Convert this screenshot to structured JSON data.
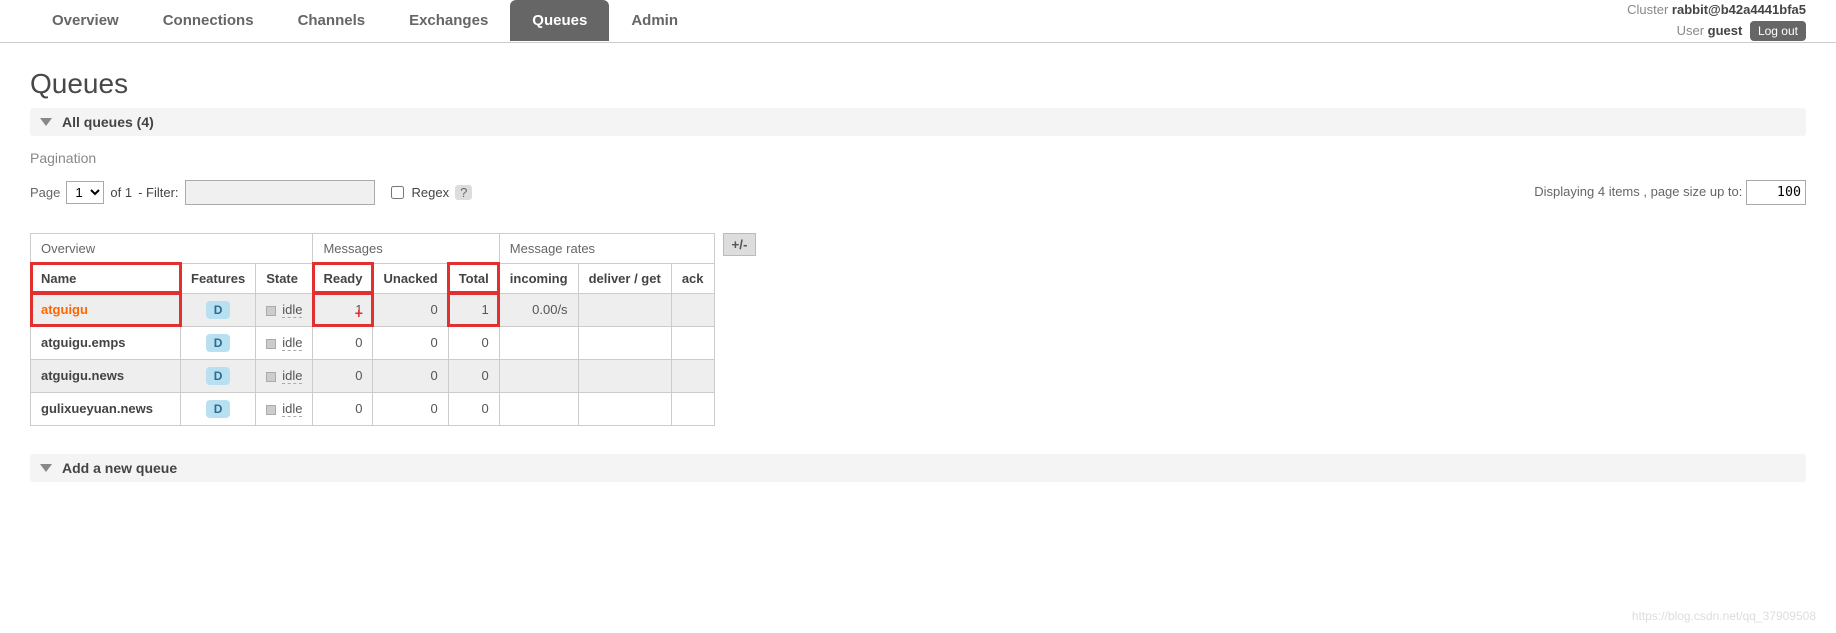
{
  "cluster": {
    "label": "Cluster",
    "name": "rabbit@b42a4441bfa5"
  },
  "user": {
    "label": "User",
    "name": "guest",
    "logout": "Log out"
  },
  "tabs": [
    {
      "label": "Overview"
    },
    {
      "label": "Connections"
    },
    {
      "label": "Channels"
    },
    {
      "label": "Exchanges"
    },
    {
      "label": "Queues"
    },
    {
      "label": "Admin"
    }
  ],
  "page_title": "Queues",
  "sections": {
    "all_queues": "All queues (4)",
    "add_queue": "Add a new queue"
  },
  "pagination": {
    "label": "Pagination",
    "page_label": "Page",
    "page_value": "1",
    "of_label": "of 1",
    "filter_label": "- Filter:",
    "filter_value": "",
    "regex_label": "Regex",
    "help": "?",
    "display_label": "Displaying 4 items , page size up to:",
    "pagesize_value": "100"
  },
  "table": {
    "group_headers": {
      "overview": "Overview",
      "messages": "Messages",
      "rates": "Message rates"
    },
    "headers": {
      "name": "Name",
      "features": "Features",
      "state": "State",
      "ready": "Ready",
      "unacked": "Unacked",
      "total": "Total",
      "incoming": "incoming",
      "deliver": "deliver / get",
      "ack": "ack"
    },
    "rows": [
      {
        "name": "atguigu",
        "feature": "D",
        "state": "idle",
        "ready": "1",
        "unacked": "0",
        "total": "1",
        "incoming": "0.00/s",
        "deliver": "",
        "ack": ""
      },
      {
        "name": "atguigu.emps",
        "feature": "D",
        "state": "idle",
        "ready": "0",
        "unacked": "0",
        "total": "0",
        "incoming": "",
        "deliver": "",
        "ack": ""
      },
      {
        "name": "atguigu.news",
        "feature": "D",
        "state": "idle",
        "ready": "0",
        "unacked": "0",
        "total": "0",
        "incoming": "",
        "deliver": "",
        "ack": ""
      },
      {
        "name": "gulixueyuan.news",
        "feature": "D",
        "state": "idle",
        "ready": "0",
        "unacked": "0",
        "total": "0",
        "incoming": "",
        "deliver": "",
        "ack": ""
      }
    ],
    "plusminus": "+/-"
  },
  "watermark": "https://blog.csdn.net/qq_37909508"
}
